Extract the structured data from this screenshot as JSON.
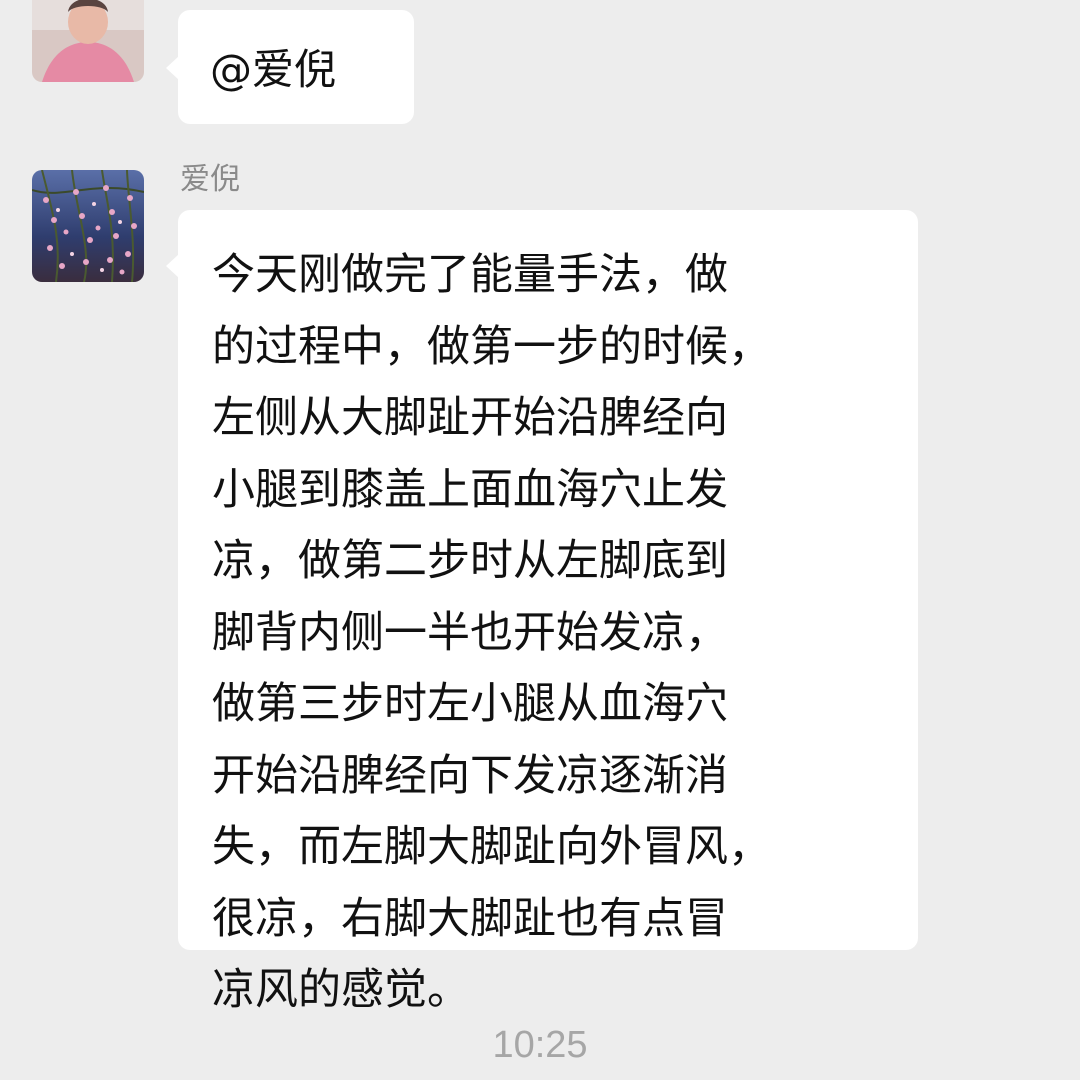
{
  "messages": [
    {
      "avatar": "avatar-elderly-woman",
      "text_lines": [
        "@爱倪"
      ]
    },
    {
      "sender_name": "爱倪",
      "avatar": "avatar-flower-branches",
      "text_lines": [
        "今天刚做完了能量手法，做",
        "的过程中，做第一步的时候，",
        "左侧从大脚趾开始沿脾经向",
        "小腿到膝盖上面血海穴止发",
        "凉，做第二步时从左脚底到",
        "脚背内侧一半也开始发凉，",
        "做第三步时左小腿从血海穴",
        "开始沿脾经向下发凉逐渐消",
        "失，而左脚大脚趾向外冒风，",
        "很凉，右脚大脚趾也有点冒",
        "凉风的感觉。"
      ]
    }
  ],
  "timestamp": "10:25",
  "colors": {
    "background": "#ededed",
    "bubble": "#ffffff",
    "name_text": "#8a8a8a",
    "timestamp_text": "#a6a6a6"
  }
}
